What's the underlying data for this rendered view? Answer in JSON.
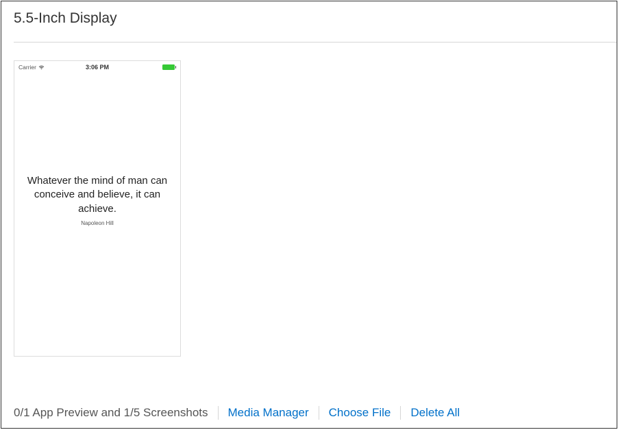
{
  "section": {
    "title": "5.5-Inch Display"
  },
  "screenshot": {
    "status_bar": {
      "carrier": "Carrier",
      "time": "3:06 PM"
    },
    "quote": "Whatever the mind of man can conceive and believe, it can achieve.",
    "author": "Napoleon Hill"
  },
  "footer": {
    "status": "0/1 App Preview and 1/5 Screenshots",
    "media_manager": "Media Manager",
    "choose_file": "Choose File",
    "delete_all": "Delete All"
  }
}
